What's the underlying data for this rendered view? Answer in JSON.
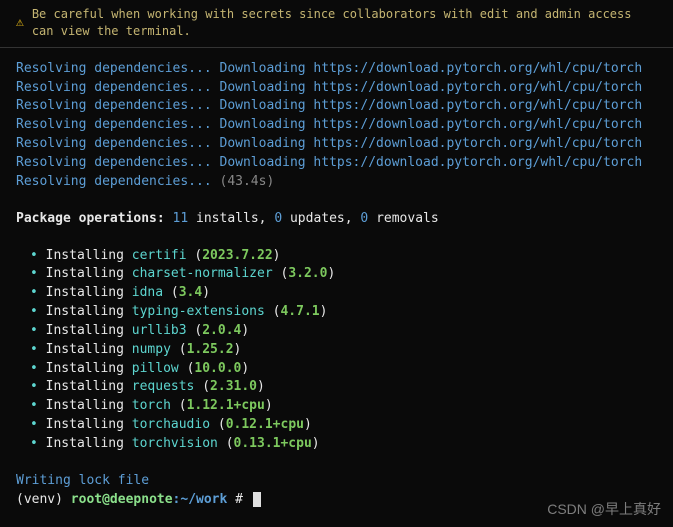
{
  "warning": {
    "icon": "⚠",
    "text": "Be careful when working with secrets since collaborators with edit and admin access can view the terminal."
  },
  "resolving": {
    "prefix": "Resolving dependencies...",
    "download_label": "Downloading",
    "url": "https://download.pytorch.org/whl/cpu/torch",
    "final_time": "(43.4s)",
    "repeat_count": 6
  },
  "operations": {
    "label": "Package operations",
    "installs": "11",
    "installs_label": "installs,",
    "updates": "0",
    "updates_label": "updates,",
    "removals": "0",
    "removals_label": "removals"
  },
  "installs": [
    {
      "action": "Installing",
      "pkg": "certifi",
      "ver": "2023.7.22"
    },
    {
      "action": "Installing",
      "pkg": "charset-normalizer",
      "ver": "3.2.0"
    },
    {
      "action": "Installing",
      "pkg": "idna",
      "ver": "3.4"
    },
    {
      "action": "Installing",
      "pkg": "typing-extensions",
      "ver": "4.7.1"
    },
    {
      "action": "Installing",
      "pkg": "urllib3",
      "ver": "2.0.4"
    },
    {
      "action": "Installing",
      "pkg": "numpy",
      "ver": "1.25.2"
    },
    {
      "action": "Installing",
      "pkg": "pillow",
      "ver": "10.0.0"
    },
    {
      "action": "Installing",
      "pkg": "requests",
      "ver": "2.31.0"
    },
    {
      "action": "Installing",
      "pkg": "torch",
      "ver": "1.12.1+cpu"
    },
    {
      "action": "Installing",
      "pkg": "torchaudio",
      "ver": "0.12.1+cpu"
    },
    {
      "action": "Installing",
      "pkg": "torchvision",
      "ver": "0.13.1+cpu"
    }
  ],
  "footer": {
    "writing": "Writing lock file",
    "venv": "(venv) ",
    "user": "root@deepnote",
    "path": ":~/work",
    "prompt": " # "
  },
  "watermark": "CSDN @早上真好"
}
